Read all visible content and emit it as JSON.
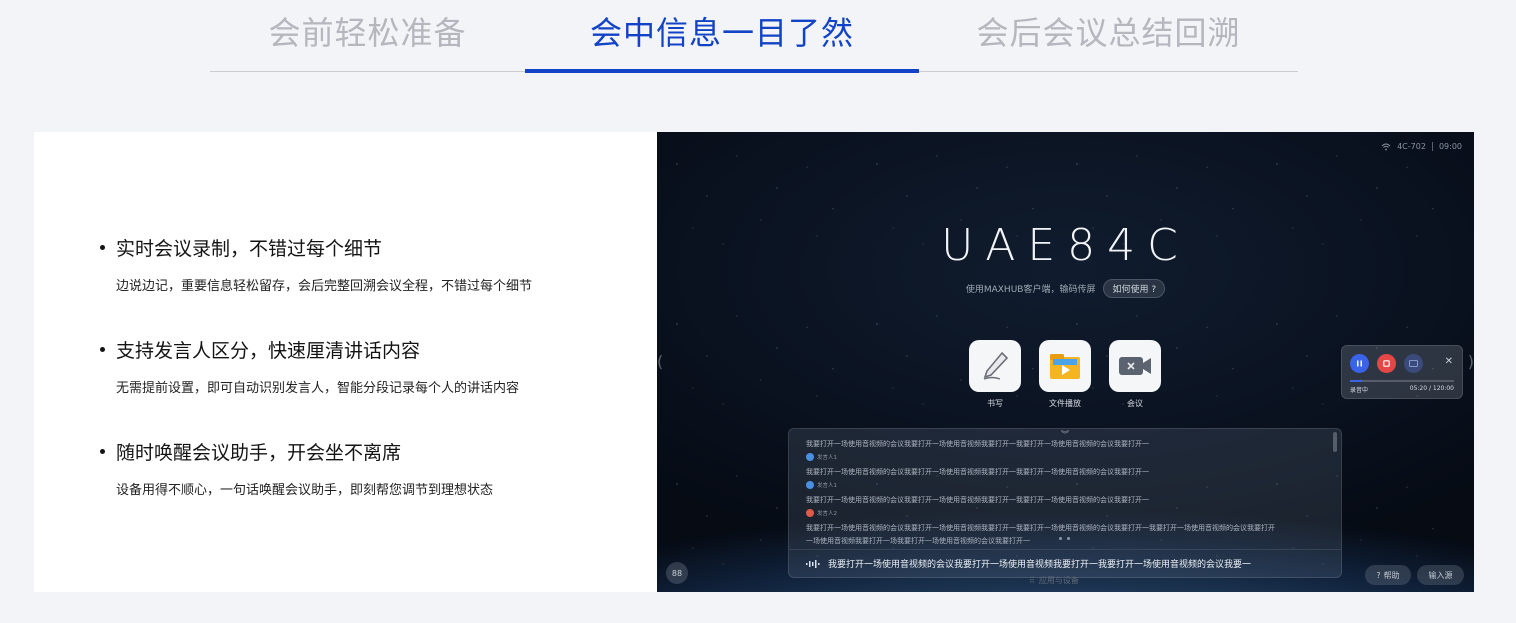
{
  "tabs": [
    {
      "label": "会前轻松准备",
      "active": false
    },
    {
      "label": "会中信息一目了然",
      "active": true
    },
    {
      "label": "会后会议总结回溯",
      "active": false
    }
  ],
  "colors": {
    "accent": "#1242c6",
    "inactive_tab": "#b4b7bd"
  },
  "features": [
    {
      "title": "实时会议录制，不错过每个细节",
      "desc": "边说边记，重要信息轻松留存，会后完整回溯会议全程，不错过每个细节"
    },
    {
      "title": "支持发言人区分，快速厘清讲话内容",
      "desc": "无需提前设置，即可自动识别发言人，智能分段记录每个人的讲话内容"
    },
    {
      "title": "随时唤醒会议助手，开会坐不离席",
      "desc": "设备用得不顺心，一句话唤醒会议助手，即刻帮您调节到理想状态"
    }
  ],
  "device": {
    "status": {
      "room": "4C-702",
      "time": "09:00",
      "icon": "wifi-icon"
    },
    "room_code": "UAE84C",
    "hint": "使用MAXHUB客户端，输码传屏",
    "hint_button": "如何使用",
    "apps": [
      {
        "label": "书写",
        "icon": "pen-icon"
      },
      {
        "label": "文件播放",
        "icon": "folder-play-icon"
      },
      {
        "label": "会议",
        "icon": "camera-icon"
      }
    ],
    "recorder": {
      "state": "录音中",
      "elapsed": "05:20 / 120:00",
      "progress": 0.12
    },
    "transcript": {
      "lines": [
        "我要打开一场使用音视频的会议我要打开一场使用音视频我要打开一我要打开一场使用音视频的会议我要打开一",
        "我要打开一场使用音视频的会议我要打开一场使用音视频我要打开一我要打开一场使用音视频的会议我要打开一",
        "我要打开一场使用音视频的会议我要打开一场使用音视频我要打开一我要打开一场使用音视频的会议我要打开一"
      ],
      "speakers": [
        "发言人1",
        "发言人1",
        "发言人2"
      ],
      "long_line_1": "我要打开一场使用音视频的会议我要打开一场使用音视频我要打开一我要打开一场使用音视频的会议我要打开一我要打开一场使用音视频的会议我要打开",
      "long_line_2": "一场使用音视频我要打开一场我要打开一场使用音视频的会议我要打开一",
      "live_text": "我要打开一场使用音视频的会议我要打开一场使用音视频我要打开一我要打开一场使用音视频的会议我要一"
    },
    "bottom": {
      "left": "88",
      "center": "应用与设备",
      "help": "帮助",
      "join": "输入源"
    }
  }
}
